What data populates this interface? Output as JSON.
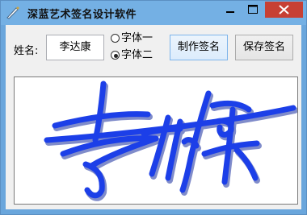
{
  "window": {
    "title": "深蓝艺术签名设计软件"
  },
  "form": {
    "name_label": "姓名:",
    "name_value": "李达康",
    "fonts": [
      {
        "label": "字体一",
        "selected": false
      },
      {
        "label": "字体二",
        "selected": true
      }
    ],
    "make_button": "制作签名",
    "save_button": "保存签名"
  },
  "colors": {
    "titlebar": "#74b0e4",
    "close": "#c74034",
    "signature": "#1c3fe8"
  }
}
